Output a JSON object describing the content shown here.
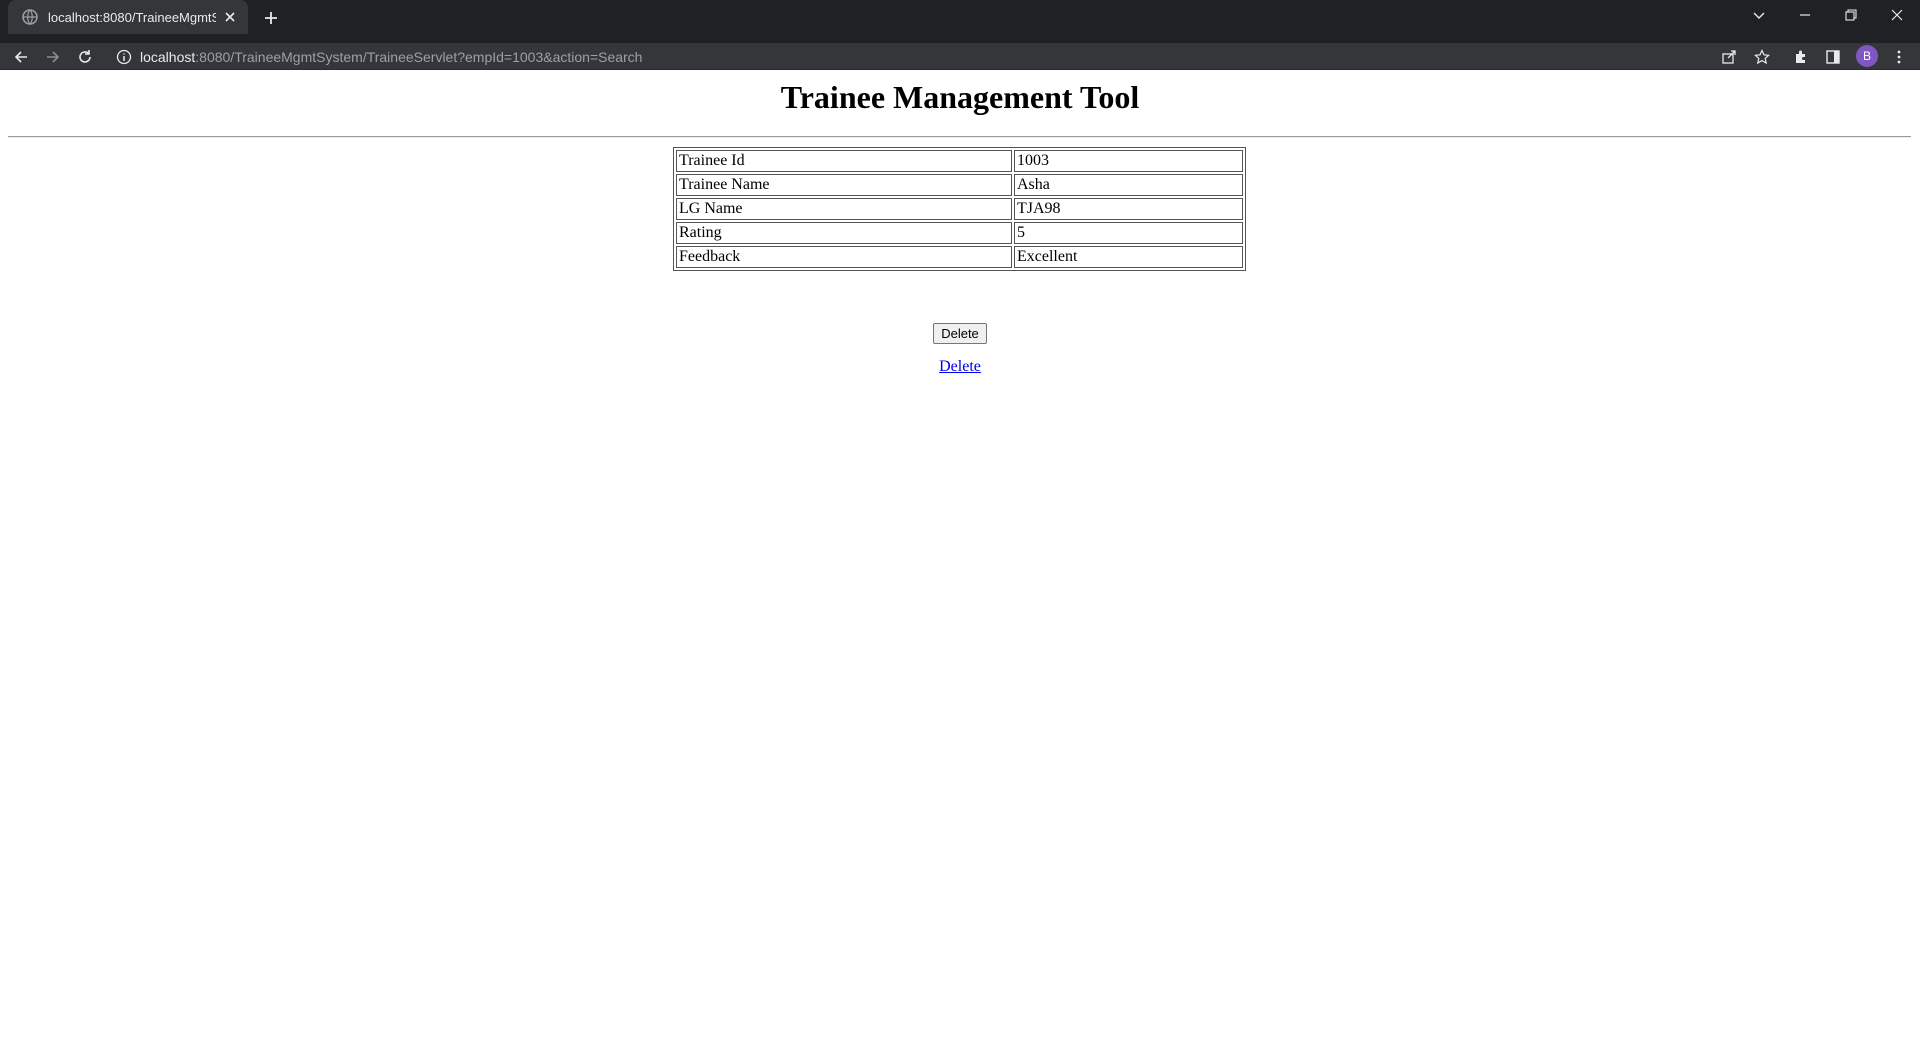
{
  "browser": {
    "tab_title": "localhost:8080/TraineeMgmtSyste",
    "url_host": "localhost",
    "url_rest": ":8080/TraineeMgmtSystem/TraineeServlet?empId=1003&action=Search",
    "profile_initial": "B"
  },
  "page": {
    "heading": "Trainee Management Tool",
    "details": [
      {
        "label": "Trainee Id",
        "value": "1003"
      },
      {
        "label": "Trainee Name",
        "value": "Asha"
      },
      {
        "label": "LG Name",
        "value": "TJA98"
      },
      {
        "label": "Rating",
        "value": "5"
      },
      {
        "label": "Feedback",
        "value": "Excellent"
      }
    ],
    "delete_button_label": "Delete",
    "delete_link_label": "Delete"
  },
  "colors": {
    "chrome_dark": "#202124",
    "chrome_tab": "#35363a",
    "link": "#0000ee",
    "avatar": "#7e57c2"
  }
}
